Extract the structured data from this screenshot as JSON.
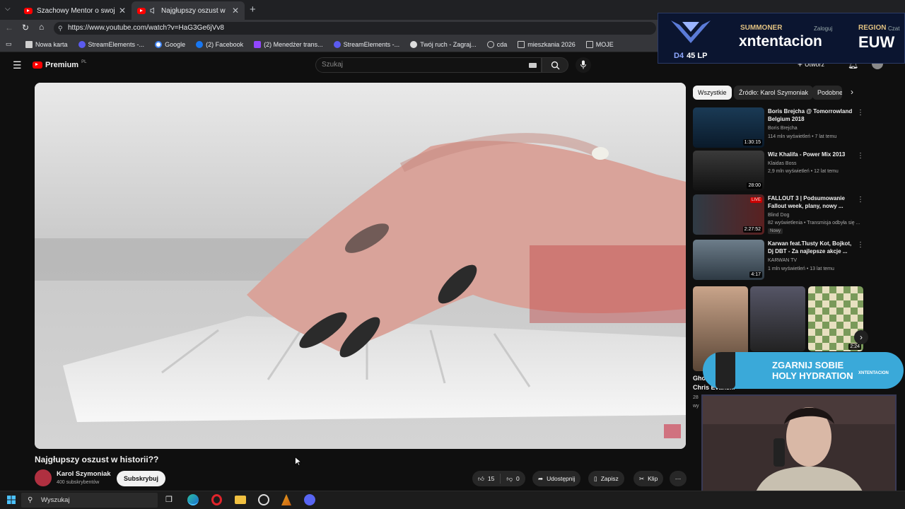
{
  "browser": {
    "tabs": [
      {
        "label": "Szachowy Mentor o swojej działalności",
        "active": false
      },
      {
        "label": "Najgłupszy oszust w historii??",
        "active": true
      }
    ],
    "url": "https://www.youtube.com/watch?v=HaG3Ge6jVv8",
    "bookmarks": [
      {
        "label": "Nowa karta",
        "icon": "page-icon"
      },
      {
        "label": "StreamElements -...",
        "icon": "streamelements-icon"
      },
      {
        "label": "Google",
        "icon": "google-icon"
      },
      {
        "label": "(2) Facebook",
        "icon": "facebook-icon"
      },
      {
        "label": "(2) Menedżer trans...",
        "icon": "twitch-icon"
      },
      {
        "label": "StreamElements -...",
        "icon": "streamelements-icon"
      },
      {
        "label": "Twój ruch - Zagraj...",
        "icon": "chess-icon"
      },
      {
        "label": "cda",
        "icon": "globe-icon"
      },
      {
        "label": "mieszkania 2026",
        "icon": "folder-icon"
      },
      {
        "label": "MOJE",
        "icon": "folder-icon"
      }
    ]
  },
  "youtube": {
    "logo": "Premium",
    "logo_region": "PL",
    "search_placeholder": "Szukaj",
    "create_label": "Utwórz",
    "chips": [
      "Wszystkie",
      "Źródło: Karol Szymoniak",
      "Podobne"
    ],
    "video": {
      "title": "Najgłupszy oszust w historii??",
      "channel": "Karol Szymoniak",
      "subscribers": "400 subskrybentów",
      "subscribe_label": "Subskrybuj",
      "likes": "15",
      "dislikes": "0",
      "share_label": "Udostępnij",
      "save_label": "Zapisz",
      "clip_label": "Klip"
    },
    "recommendations": [
      {
        "title": "Boris Brejcha @ Tomorrowland Belgium 2018",
        "channel": "Boris Brejcha",
        "meta": "114 mln wyświetleń • 7 lat temu",
        "duration": "1:30:15"
      },
      {
        "title": "Wiz Khalifa - Power Mix 2013",
        "channel": "Klaidas Boss",
        "meta": "2,9 mln wyświetleń • 12 lat temu",
        "duration": "28:00"
      },
      {
        "title": "FALLOUT 3 | Podsumowanie Fallout week, plany, nowy ...",
        "channel": "Blind Dog",
        "meta": "82 wyświetlenia • Transmisja odbyła się ...",
        "duration": "2:27:52",
        "badge": "Nowy",
        "live_badge": "LIVE"
      },
      {
        "title": "Karwan feat.Tlusty Kot, Bojkot, Dj DBT - Za najlepsze akcje ...",
        "channel": "KARWAN TV",
        "meta": "1 mln wyświetleń • 13 lat temu",
        "duration": "4:17"
      }
    ],
    "shorts_partial": {
      "title_1": "Gho",
      "title_2": "Chris Evans...",
      "meta_1": "28",
      "meta_2": "wy",
      "chess_duration": "2:24"
    }
  },
  "overlay": {
    "rank": "D4",
    "lp": "45 LP",
    "summoner_label": "SUMMONER",
    "summoner_name": "xntentacion",
    "login_label": "Zaloguj",
    "region_label": "REGION",
    "region": "EUW",
    "chat_label": "Czat",
    "promo_line1": "ZGARNIJ SOBIE",
    "promo_line2": "HOLY HYDRATION",
    "promo_tag": "XNTENTACION"
  },
  "taskbar": {
    "search_label": "Wyszukaj",
    "apps": [
      "task-view-icon",
      "edge-icon",
      "opera-icon",
      "file-explorer-icon",
      "chess-app-icon",
      "app-icon",
      "discord-icon"
    ]
  },
  "colors": {
    "yt_red": "#ff0000",
    "background": "#0f0f0f",
    "subscribe_bg": "#f1f1f1"
  }
}
